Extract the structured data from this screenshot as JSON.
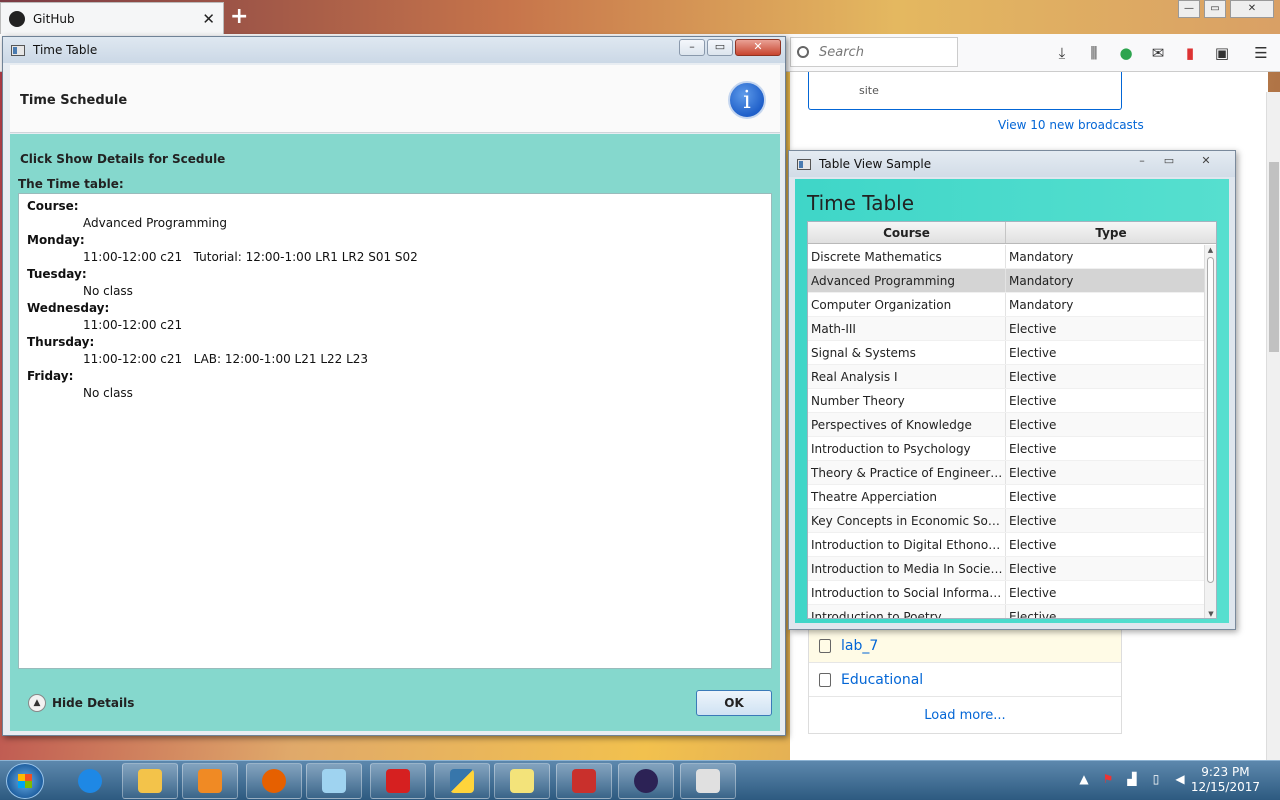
{
  "browser": {
    "tab_title": "GitHub",
    "tab_close": "✕",
    "new_tab": "+",
    "search_placeholder": "Search",
    "page_snippet": "site",
    "broadcasts_link": "View 10 new broadcasts",
    "repos": [
      {
        "name": "lab_7"
      },
      {
        "name": "Educational"
      }
    ],
    "load_more": "Load more..."
  },
  "time_table_dialog": {
    "title": "Time Table",
    "header_title": "Time Schedule",
    "info_symbol": "i",
    "message": "Click Show Details for Scedule",
    "table_label": "The Time table:",
    "schedule": [
      {
        "label": "Course:",
        "value": "Advanced Programming"
      },
      {
        "label": "Monday:",
        "value": "11:00-12:00 c21   Tutorial: 12:00-1:00 LR1 LR2 S01 S02"
      },
      {
        "label": "Tuesday:",
        "value": "No class"
      },
      {
        "label": "Wednesday:",
        "value": "11:00-12:00 c21"
      },
      {
        "label": "Thursday:",
        "value": "11:00-12:00 c21   LAB: 12:00-1:00 L21 L22 L23"
      },
      {
        "label": "Friday:",
        "value": "No class"
      }
    ],
    "hide_details": "Hide Details",
    "ok_label": "OK"
  },
  "table_view_window": {
    "title": "Table View Sample",
    "heading": "Time Table",
    "columns": [
      "Course",
      "Type"
    ],
    "rows": [
      {
        "course": "Discrete Mathematics",
        "type": "Mandatory"
      },
      {
        "course": "Advanced Programming",
        "type": "Mandatory"
      },
      {
        "course": "Computer Organization",
        "type": "Mandatory"
      },
      {
        "course": "Math-III",
        "type": "Elective"
      },
      {
        "course": "Signal & Systems",
        "type": "Elective"
      },
      {
        "course": "Real Analysis I",
        "type": "Elective"
      },
      {
        "course": "Number Theory",
        "type": "Elective"
      },
      {
        "course": "Perspectives of Knowledge",
        "type": "Elective"
      },
      {
        "course": "Introduction to Psychology",
        "type": "Elective"
      },
      {
        "course": "Theory & Practice of Engineering E...",
        "type": "Elective"
      },
      {
        "course": "Theatre Apperciation",
        "type": "Elective"
      },
      {
        "course": "Key Concepts in Economic Sociolo...",
        "type": "Elective"
      },
      {
        "course": "Introduction to Digital Ethonograp...",
        "type": "Elective"
      },
      {
        "course": "Introduction to Media In Society: ...",
        "type": "Elective"
      },
      {
        "course": "Introduction to Social Informatics(...",
        "type": "Elective"
      },
      {
        "course": "Introduction to Poetry",
        "type": "Elective"
      }
    ],
    "selected_index": 1
  },
  "taskbar": {
    "apps": [
      "internet-explorer",
      "file-explorer",
      "media-player",
      "firefox",
      "notepad",
      "sunshine-app",
      "python",
      "sticky-notes",
      "remote-app",
      "eclipse",
      "java"
    ],
    "time": "9:23 PM",
    "date": "12/15/2017"
  },
  "colors": {
    "dialog_content": "#85d8cd",
    "table_window_bg": "#3fd6c8",
    "info_blue": "#1f5fc9",
    "link_blue": "#0366d6"
  }
}
